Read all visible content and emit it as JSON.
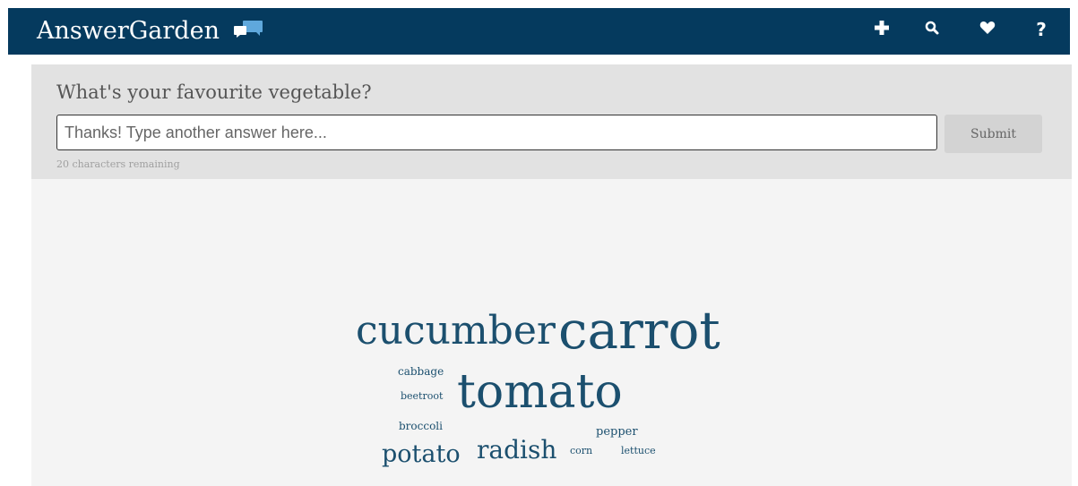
{
  "header": {
    "brand": "AnswerGarden",
    "brand_logo_icon": "speech-bubbles-icon",
    "icons": [
      "plus-icon",
      "search-icon",
      "heart-icon",
      "help-icon"
    ],
    "help_glyph": "?",
    "background_color": "#053a5e"
  },
  "form": {
    "question": "What's your favourite vegetable?",
    "input_placeholder": "Thanks! Type another answer here...",
    "input_value": "",
    "submit_label": "Submit",
    "remaining_text": "20 characters remaining"
  },
  "word_cloud": {
    "text_color": "#1b4f6e",
    "words": [
      "cucumber",
      "carrot",
      "cabbage",
      "beetroot",
      "tomato",
      "broccoli",
      "pepper",
      "potato",
      "radish",
      "corn",
      "lettuce"
    ]
  }
}
